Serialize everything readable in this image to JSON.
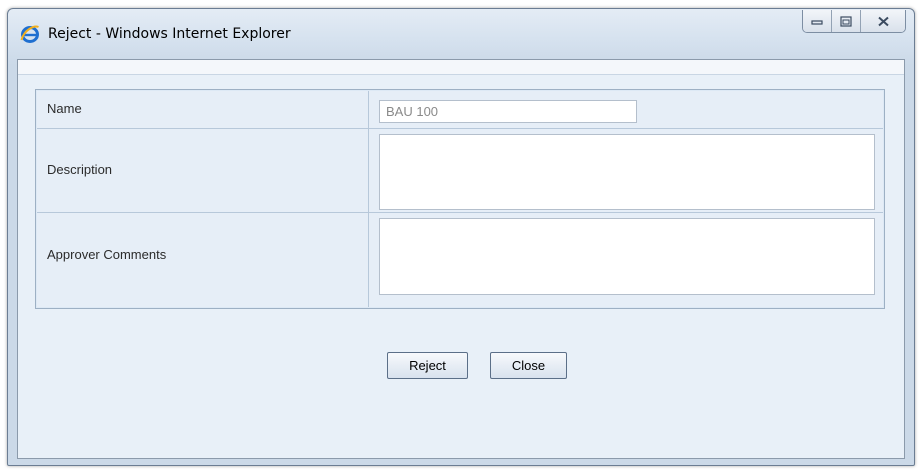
{
  "window": {
    "title": "Reject - Windows Internet Explorer",
    "app_icon": "internet-explorer-icon",
    "caption_buttons": [
      "minimize-icon",
      "maximize-icon",
      "close-icon"
    ]
  },
  "form": {
    "name_label": "Name",
    "name_value": "BAU 100",
    "description_label": "Description",
    "description_value": "",
    "approver_comments_label": "Approver Comments",
    "approver_comments_value": ""
  },
  "actions": {
    "reject_label": "Reject",
    "close_label": "Close"
  }
}
